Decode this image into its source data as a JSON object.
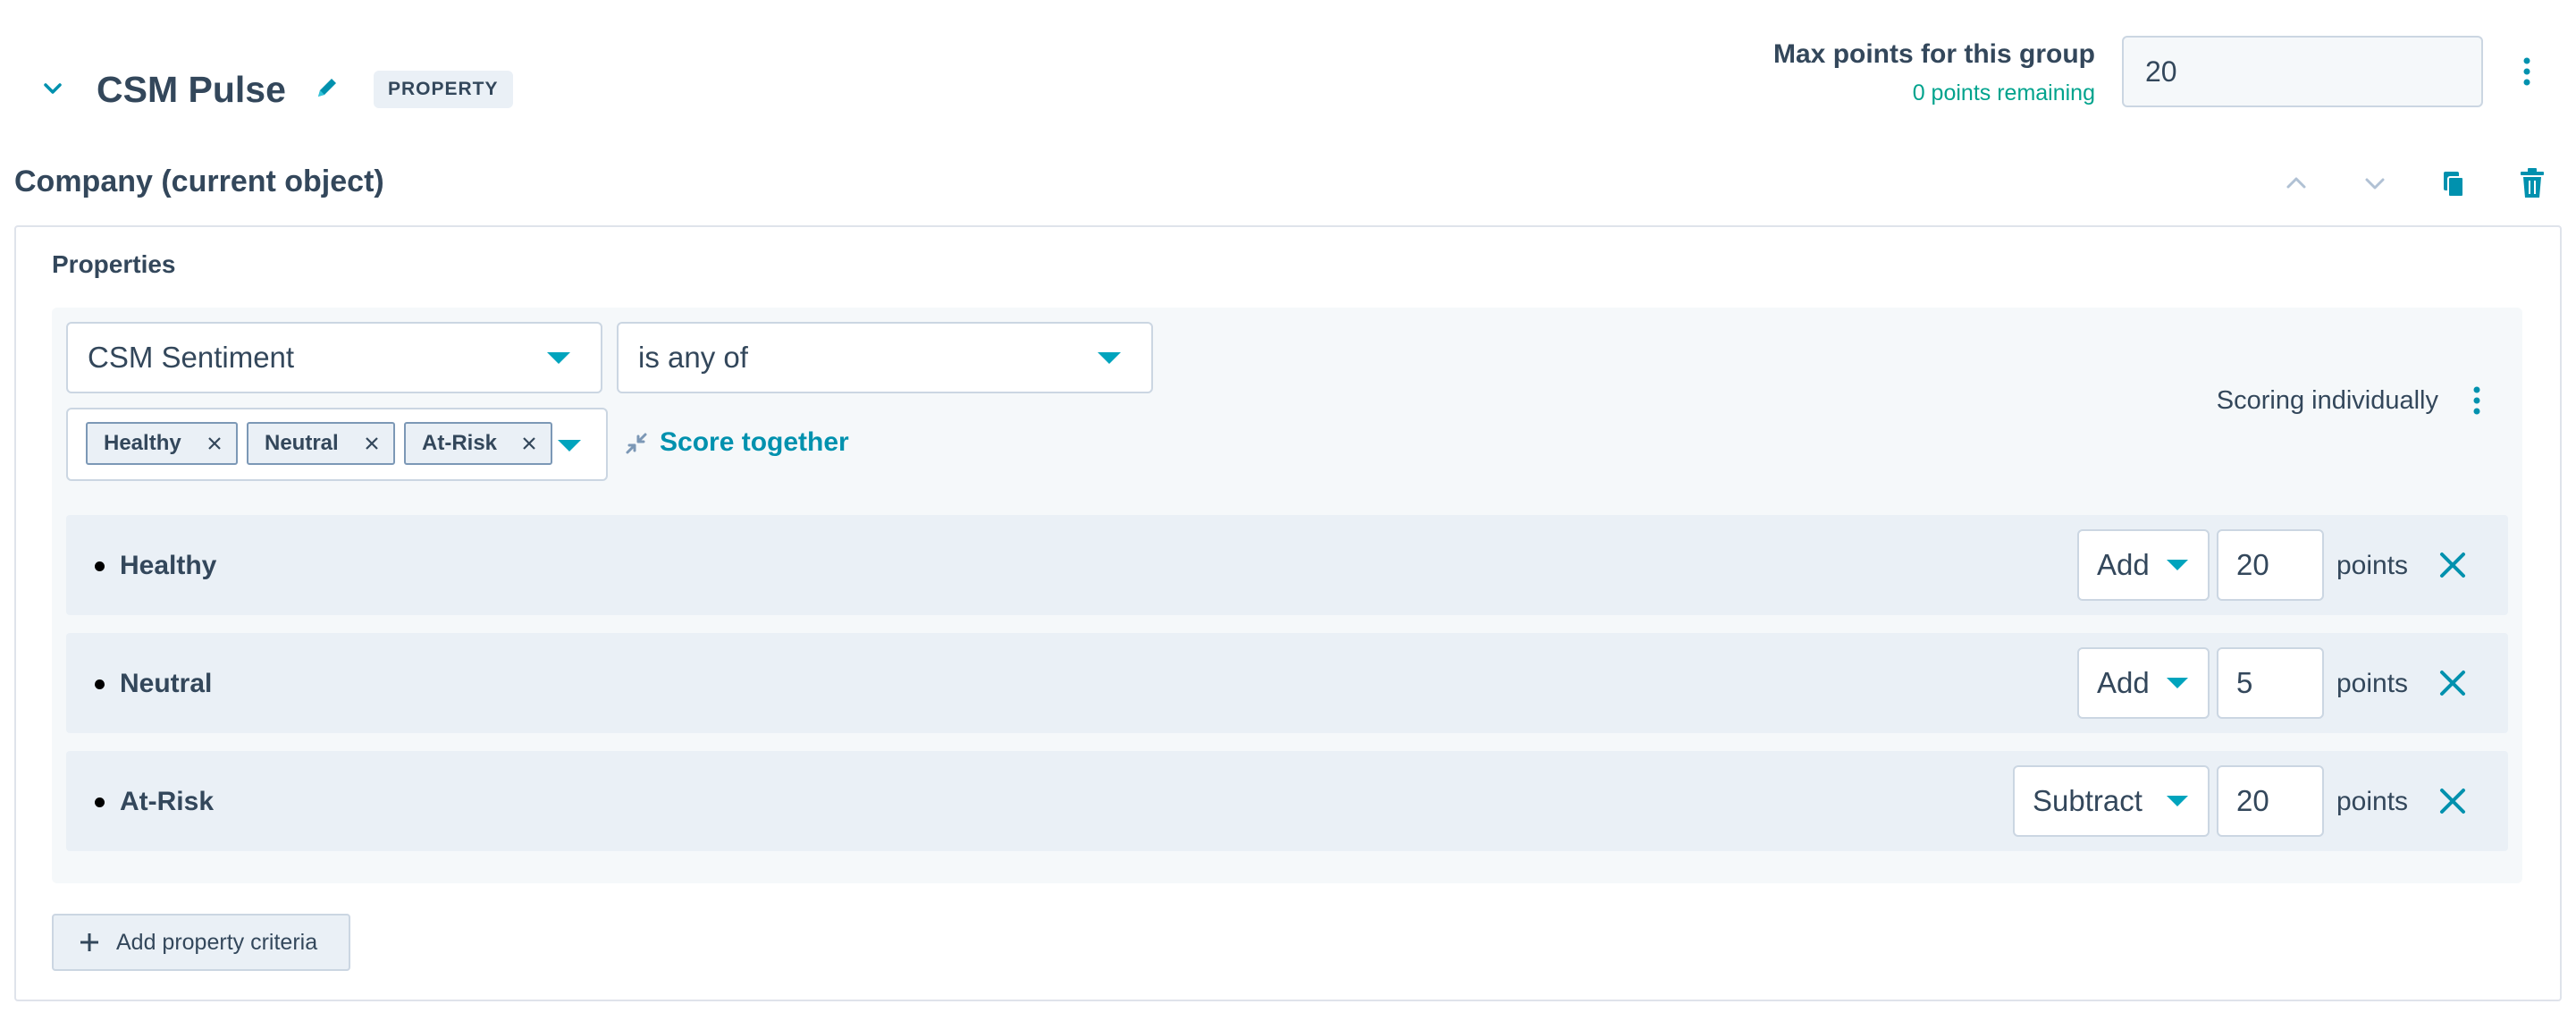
{
  "header": {
    "collapse_icon": "chevron-down-icon",
    "title": "CSM Pulse",
    "edit_icon": "pencil-icon",
    "badge": "PROPERTY",
    "max_points_label": "Max points for this group",
    "points_remaining": "0 points remaining",
    "max_points_value": "20",
    "more_icon": "kebab-icon"
  },
  "object": {
    "title": "Company (current object)",
    "actions": [
      "chevron-up-icon",
      "chevron-down-icon",
      "copy-icon",
      "trash-icon"
    ]
  },
  "properties": {
    "label": "Properties",
    "property_select": "CSM Sentiment",
    "operator_select": "is any of",
    "selected_values": [
      "Healthy",
      "Neutral",
      "At-Risk"
    ],
    "score_together": "Score together",
    "scoring_mode": "Scoring individually",
    "rows": [
      {
        "label": "Healthy",
        "operation": "Add",
        "points": "20",
        "unit": "points"
      },
      {
        "label": "Neutral",
        "operation": "Add",
        "points": "5",
        "unit": "points"
      },
      {
        "label": "At-Risk",
        "operation": "Subtract",
        "points": "20",
        "unit": "points"
      }
    ],
    "add_criteria": "Add property criteria"
  },
  "colors": {
    "accent": "#00a4bd",
    "link": "#0091ae",
    "success": "#00a38d",
    "text": "#33475b"
  }
}
